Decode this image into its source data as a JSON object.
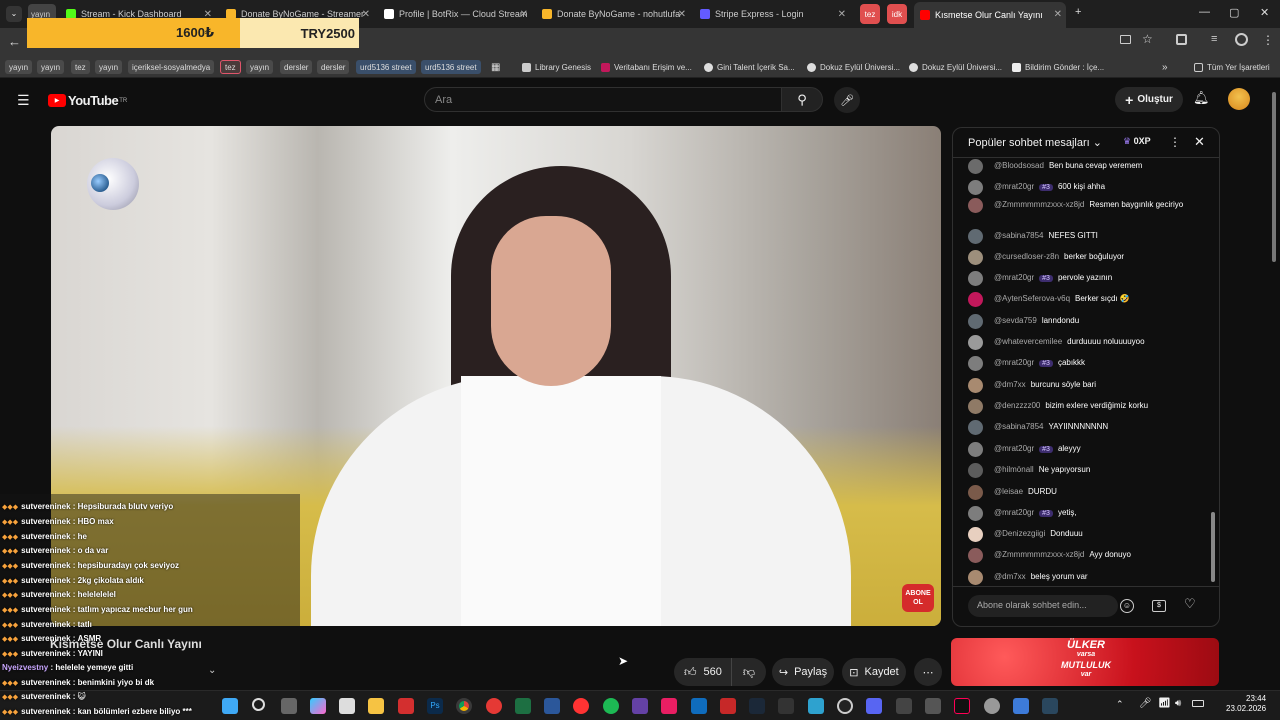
{
  "tabs": [
    {
      "label": "yayın",
      "color": "#e04f4f"
    },
    {
      "label": "Stream - Kick Dashboard",
      "color": "#53fc18"
    },
    {
      "label": "Donate ByNoGame - Streamer",
      "color": "#f8b62a"
    },
    {
      "label": "Profile | BotRix — Cloud Stream",
      "color": "#ffffff"
    },
    {
      "label": "Donate ByNoGame - nohutlufa",
      "color": "#f8b62a"
    },
    {
      "label": "Stripe Express - Login",
      "color": "#635bff"
    },
    {
      "label": "tez",
      "color": "#e04f4f"
    },
    {
      "label": "idk",
      "color": "#e04f4f"
    },
    {
      "label": "Kısmetse Olur Canlı Yayını",
      "color": "#ff0000"
    }
  ],
  "donation": {
    "left": "1600₺",
    "right": "TRY2500"
  },
  "bookmarks": [
    {
      "label": "yayın",
      "kind": "tag"
    },
    {
      "label": "yayın",
      "kind": "tag"
    },
    {
      "label": "tez",
      "kind": "tag"
    },
    {
      "label": "yayın",
      "kind": "tag"
    },
    {
      "label": "içeriksel-sosyalmedya",
      "kind": "tag"
    },
    {
      "label": "tez",
      "kind": "red"
    },
    {
      "label": "yayın",
      "kind": "tag"
    },
    {
      "label": "dersler",
      "kind": "tag"
    },
    {
      "label": "dersler",
      "kind": "tag"
    },
    {
      "label": "urd5136 street",
      "kind": "blue"
    },
    {
      "label": "urd5136 street",
      "kind": "blue"
    },
    {
      "label": "Library Genesis",
      "kind": "link"
    },
    {
      "label": "Veritabanı Erişim ve...",
      "kind": "link"
    },
    {
      "label": "Gini Talent İçerik Sa...",
      "kind": "link"
    },
    {
      "label": "Dokuz Eylül Üniversi...",
      "kind": "link"
    },
    {
      "label": "Dokuz Eylül Üniversi...",
      "kind": "link"
    },
    {
      "label": "Bildirim Gönder : İçe...",
      "kind": "link"
    }
  ],
  "bookmarks_all": "Tüm Yer İşaretleri",
  "youtube": {
    "logo": "YouTube",
    "logo_sup": "TR",
    "search_placeholder": "Ara",
    "create": "Oluştur"
  },
  "video": {
    "abone": "ABONE OL",
    "title_overlay": "Kısmetse Olur Canlı Yayını"
  },
  "actions": {
    "likes": "560",
    "share": "Paylaş",
    "save": "Kaydet"
  },
  "chat": {
    "header": "Popüler sohbet mesajları",
    "points": "0XP",
    "input_placeholder": "Abone olarak sohbet edin...",
    "messages": [
      {
        "author": "@Bloodsosad",
        "badge": "",
        "text": "Ben buna cevap veremem",
        "color": "#6b6b6b"
      },
      {
        "author": "@mrat20gr",
        "badge": "#3",
        "text": "600 kişi ahha",
        "color": "#7d7d7d"
      },
      {
        "author": "@Zmmmmmmzxxx-xz8jd",
        "badge": "",
        "text": "Resmen baygınlık geciriyo",
        "color": "#8a5b5b"
      },
      {
        "author": "@sabina7854",
        "badge": "",
        "text": "NEFES GITTI",
        "color": "#606a72"
      },
      {
        "author": "@cursedloser-z8n",
        "badge": "",
        "text": "berker boğuluyor",
        "color": "#9d8f7c"
      },
      {
        "author": "@mrat20gr",
        "badge": "#3",
        "text": "pervole yazının",
        "color": "#7d7d7d"
      },
      {
        "author": "@AytenSeferova-v6q",
        "badge": "",
        "text": "Berker sıçdı 🤣",
        "color": "#c2185b"
      },
      {
        "author": "@sevda759",
        "badge": "",
        "text": "lanndondu",
        "color": "#606a72"
      },
      {
        "author": "@whatevercemilee",
        "badge": "",
        "text": "durduuuu noluuuuyoo",
        "color": "#9a9a9a"
      },
      {
        "author": "@mrat20gr",
        "badge": "#3",
        "text": "çabıkkk",
        "color": "#7d7d7d"
      },
      {
        "author": "@dm7xx",
        "badge": "",
        "text": "burcunu söyle bari",
        "color": "#a88a70"
      },
      {
        "author": "@denzzzz00",
        "badge": "",
        "text": "bizim exlere verdiğimiz korku",
        "color": "#8f7a66"
      },
      {
        "author": "@sabina7854",
        "badge": "",
        "text": "YAYIINNNNNNN",
        "color": "#606a72"
      },
      {
        "author": "@mrat20gr",
        "badge": "#3",
        "text": "aleyyy",
        "color": "#7d7d7d"
      },
      {
        "author": "@hilmönall",
        "badge": "",
        "text": "Ne yapıyorsun",
        "color": "#5c5c5c"
      },
      {
        "author": "@leisae",
        "badge": "",
        "text": "DURDU",
        "color": "#7a5a4a"
      },
      {
        "author": "@mrat20gr",
        "badge": "#3",
        "text": "yetiş,",
        "color": "#7d7d7d"
      },
      {
        "author": "@Denizezgiigi",
        "badge": "",
        "text": "Donduuu",
        "color": "#e8d0c0"
      },
      {
        "author": "@Zmmmmmmzxxx-xz8jd",
        "badge": "",
        "text": "Ayy donuyo",
        "color": "#8a5b5b"
      },
      {
        "author": "@dm7xx",
        "badge": "",
        "text": "beleş yorum var",
        "color": "#a88a70"
      }
    ]
  },
  "overlay_chat": [
    {
      "user": "sutvereninek",
      "text": "Hepsiburada blutv veriyo"
    },
    {
      "user": "sutvereninek",
      "text": "HBO max"
    },
    {
      "user": "sutvereninek",
      "text": "he"
    },
    {
      "user": "sutvereninek",
      "text": "o da var"
    },
    {
      "user": "sutvereninek",
      "text": "hepsiburadayı çok seviyoz"
    },
    {
      "user": "sutvereninek",
      "text": "2kg çikolata aldık"
    },
    {
      "user": "sutvereninek",
      "text": "helelelelel"
    },
    {
      "user": "sutvereninek",
      "text": "tatlım yapıcaz mecbur her gun"
    },
    {
      "user": "sutvereninek",
      "text": "tatlı"
    },
    {
      "user": "sutvereninek",
      "text": "ASMR"
    },
    {
      "user": "sutvereninek",
      "text": "YAYINI"
    },
    {
      "user": "Nyeizvestny",
      "text": "helelele yemeye gitti"
    },
    {
      "user": "sutvereninek",
      "text": "benimkini yiyo bi dk"
    },
    {
      "user": "sutvereninek",
      "text": "😺"
    },
    {
      "user": "sutvereninek",
      "text": "kan bölümleri ezbere biliyo ***"
    }
  ],
  "ad": {
    "brand": "ÜLKER",
    "line2": "varsa",
    "line3": "MUTLULUK",
    "line4": "var"
  },
  "clock": {
    "time": "23:44",
    "date": "23.02.2026"
  }
}
